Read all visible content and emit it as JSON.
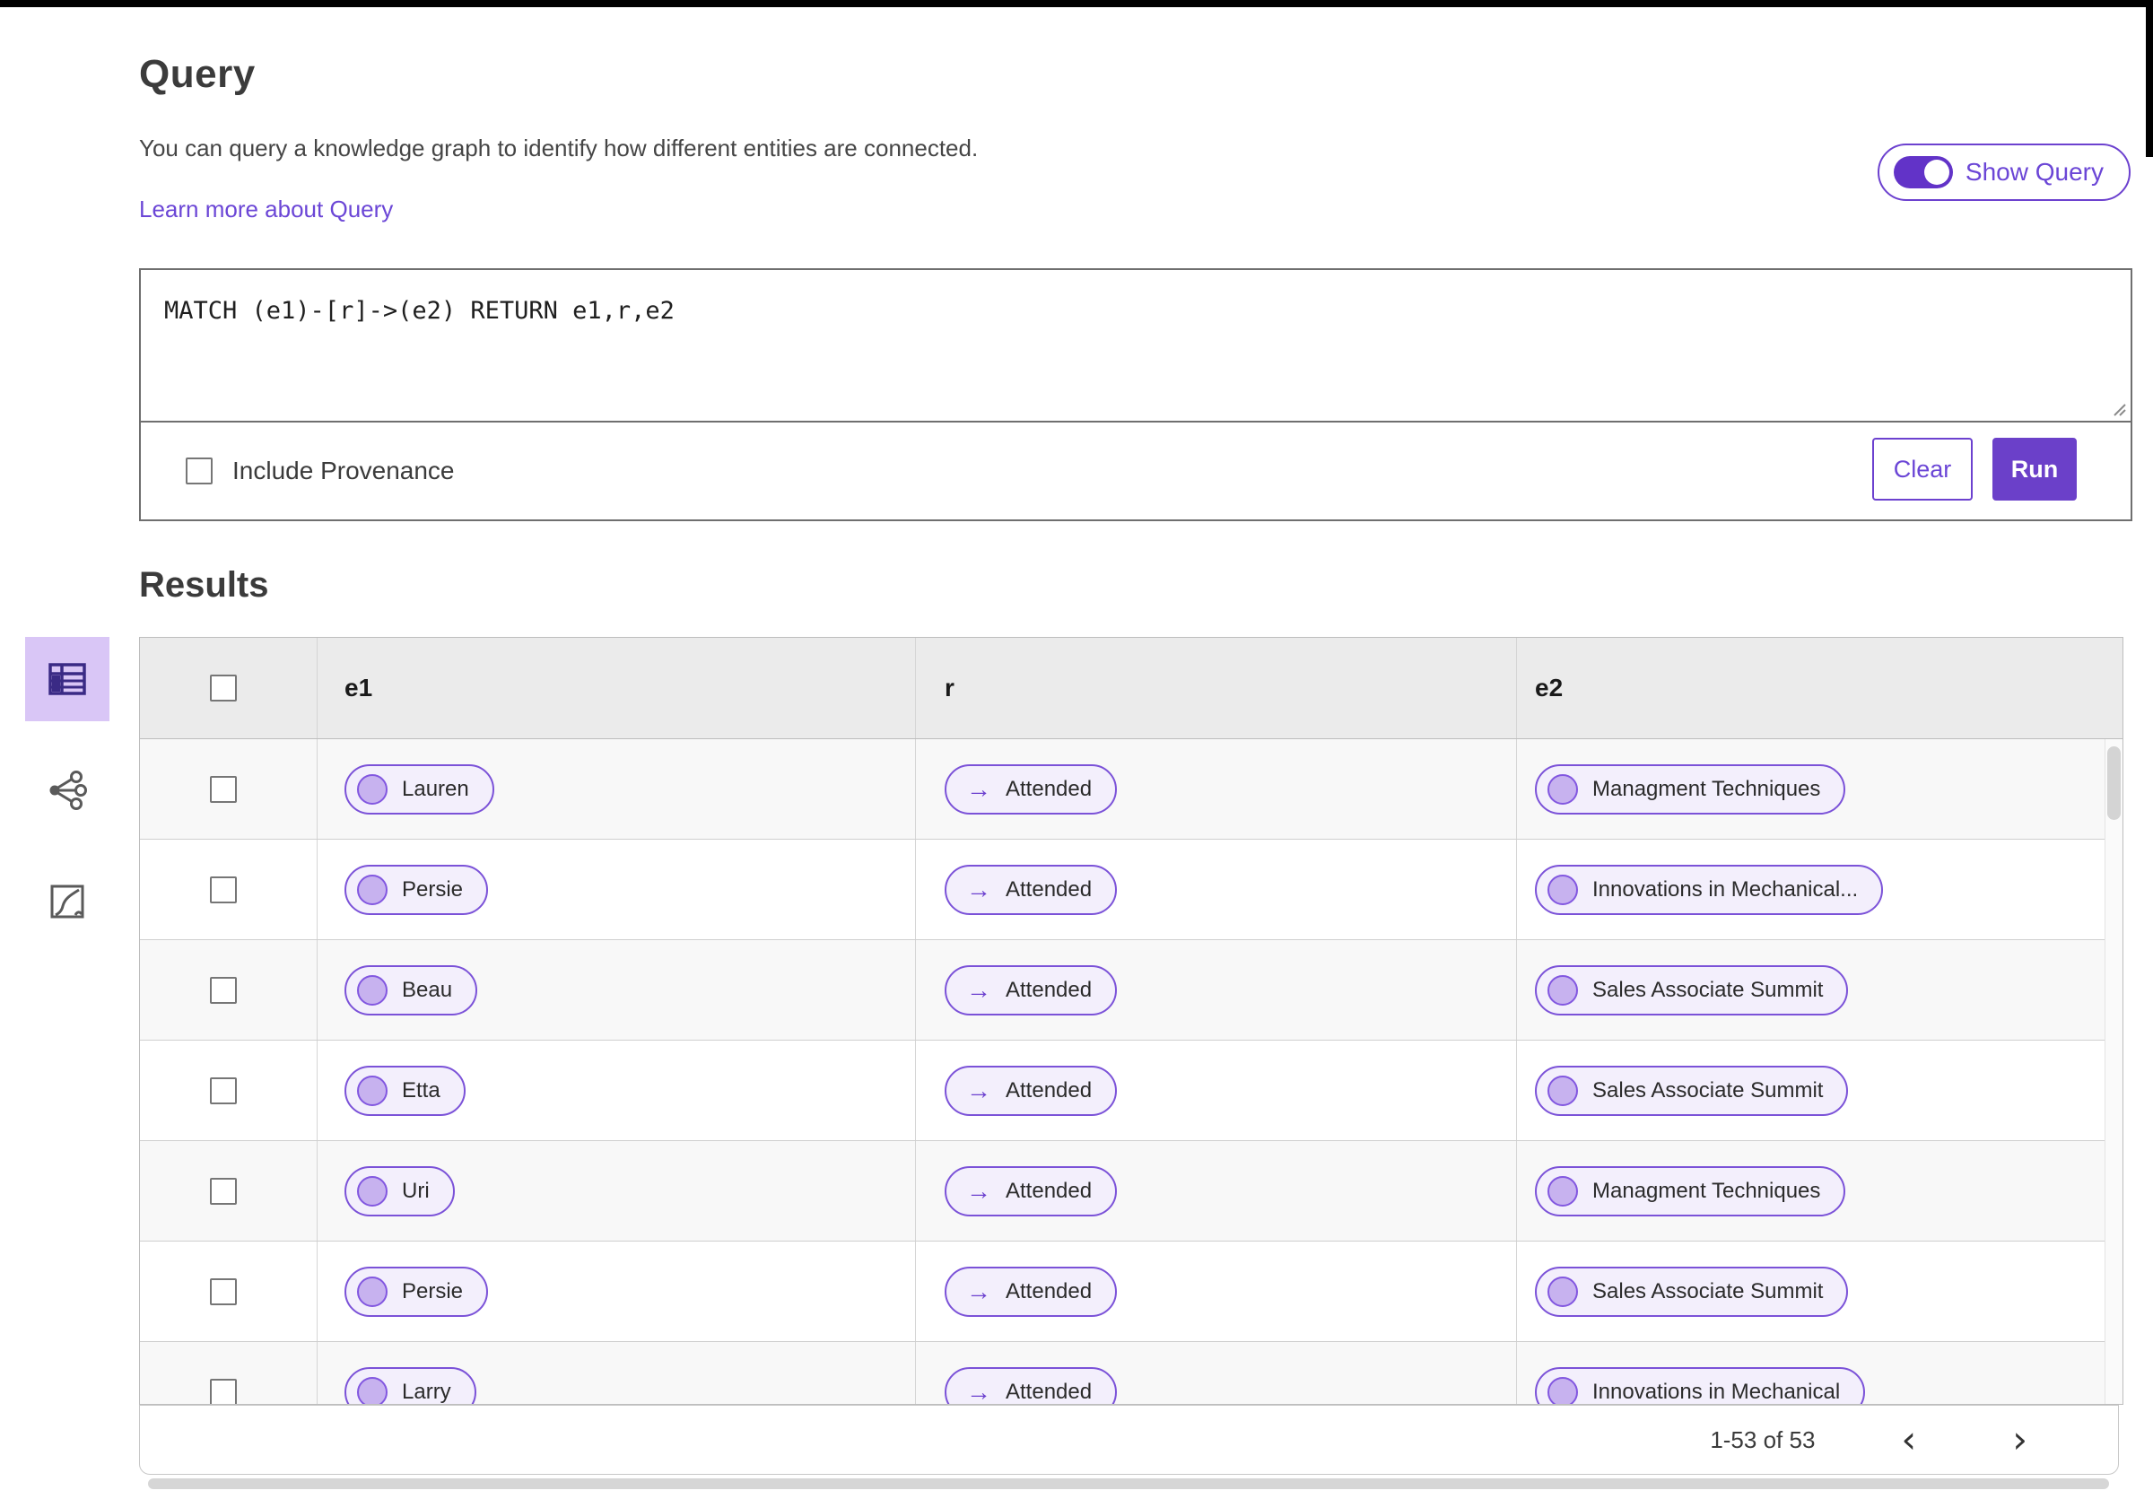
{
  "accent_color": "#6b40c9",
  "selected_view_bg": "#d9c6f6",
  "query_panel": {
    "title": "Query",
    "description": "You can query a knowledge graph to identify how different entities are connected.",
    "learn_more_link": "Learn more about Query",
    "show_query_label": "Show Query",
    "show_query_state": "on",
    "query_text": "MATCH (e1)-[r]->(e2) RETURN e1,r,e2",
    "include_provenance_label": "Include Provenance",
    "include_provenance_checked": false,
    "clear_label": "Clear",
    "run_label": "Run"
  },
  "results": {
    "title": "Results",
    "views": [
      "table-view",
      "graph-view",
      "map-view"
    ],
    "selected_view": "table-view",
    "columns": [
      "e1",
      "r",
      "e2"
    ],
    "rows": [
      {
        "e1": "Lauren",
        "r": "Attended",
        "e2": "Managment Techniques"
      },
      {
        "e1": "Persie",
        "r": "Attended",
        "e2": "Innovations in Mechanical..."
      },
      {
        "e1": "Beau",
        "r": "Attended",
        "e2": "Sales Associate Summit"
      },
      {
        "e1": "Etta",
        "r": "Attended",
        "e2": "Sales Associate Summit"
      },
      {
        "e1": "Uri",
        "r": "Attended",
        "e2": "Managment Techniques"
      },
      {
        "e1": "Persie",
        "r": "Attended",
        "e2": "Sales Associate Summit"
      },
      {
        "e1": "Larry",
        "r": "Attended",
        "e2": "Innovations in Mechanical"
      }
    ],
    "pagination": {
      "label": "1-53 of 53",
      "prev": "‹",
      "next": "›"
    }
  },
  "icons": {
    "relation_arrow": "→",
    "entity_dot": "entity-circle-icon",
    "table_view": "table-grid-icon",
    "graph_view": "graph-nodes-icon",
    "map_view": "route-icon"
  }
}
